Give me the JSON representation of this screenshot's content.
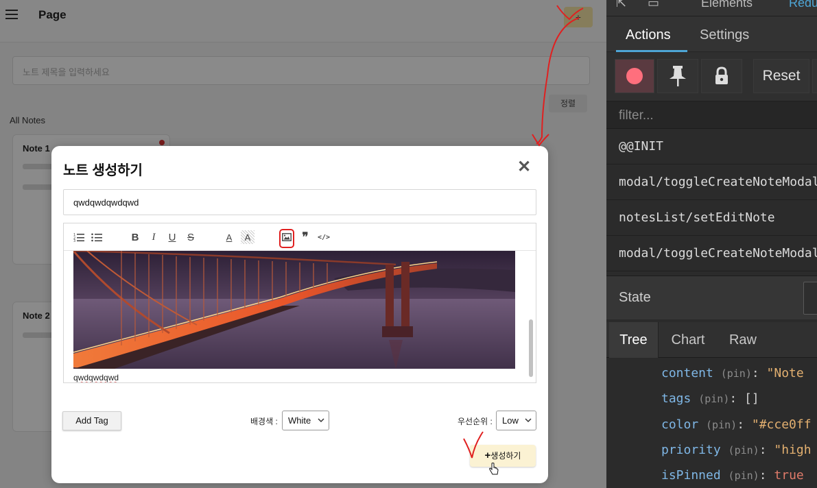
{
  "app": {
    "title": "Page",
    "search_placeholder": "노트 제목을 입력하세요",
    "sort_label": "정렬",
    "section_label": "All Notes",
    "note1_title": "Note 1",
    "note2_title": "Note 2"
  },
  "modal": {
    "title": "노트 생성하기",
    "close_icon": "close-icon",
    "title_value": "qwdqwdqwdqwd",
    "editor_text": "qwdqwdqwd",
    "add_tag_label": "Add Tag",
    "bg_color_label": "배경색 :",
    "bg_color_value": "White",
    "priority_label": "우선순위 :",
    "priority_value": "Low",
    "create_plus": "+",
    "create_label": "생성하기"
  },
  "toolbar": {
    "buttons": [
      "ordered-list-icon",
      "bullet-list-icon",
      "bold-icon",
      "italic-icon",
      "underline-icon",
      "strike-icon",
      "font-color-icon",
      "background-color-icon",
      "image-icon",
      "blockquote-icon",
      "code-block-icon"
    ],
    "bold": "B",
    "italic": "I",
    "underline": "U",
    "strike": "S",
    "font_color": "A",
    "bg_color": "A",
    "quote": "❞",
    "code": "</>"
  },
  "devtools": {
    "top_tab_elements": "Elements",
    "top_tab_redux": "Redu",
    "tabs": [
      "Actions",
      "Settings"
    ],
    "reset_label": "Reset",
    "filter_placeholder": "filter...",
    "actions": [
      "@@INIT",
      "modal/toggleCreateNoteModal",
      "notesList/setEditNote",
      "modal/toggleCreateNoteModal"
    ],
    "state_label": "State",
    "subtabs": [
      "Tree",
      "Chart",
      "Raw"
    ],
    "tree": [
      {
        "key": "content",
        "pin": "(pin)",
        "value": "\"Note"
      },
      {
        "key": "tags",
        "pin": "(pin)",
        "value": "[]"
      },
      {
        "key": "color",
        "pin": "(pin)",
        "value": "\"#cce0ff"
      },
      {
        "key": "priority",
        "pin": "(pin)",
        "value": "\"high"
      },
      {
        "key": "isPinned",
        "pin": "(pin)",
        "value": "true"
      }
    ]
  },
  "colors": {
    "annotation_red": "#e02020",
    "devtools_bg": "#2b2b2b",
    "tab_underline": "#4ea6d6",
    "record_dot": "#ff6f7d",
    "create_button_bg": "#fbf2d3"
  }
}
